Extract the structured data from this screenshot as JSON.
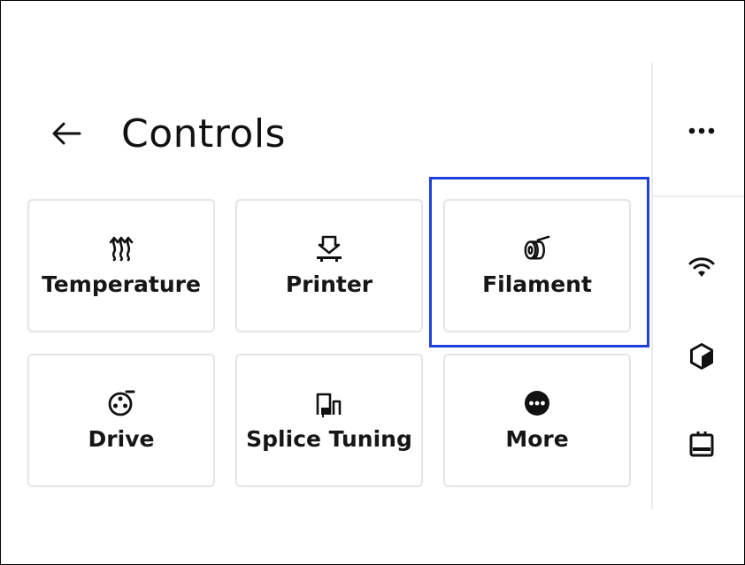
{
  "header": {
    "title": "Controls",
    "back_icon": "arrow-left-icon"
  },
  "tiles": [
    {
      "label": "Temperature",
      "icon": "heat-waves-icon"
    },
    {
      "label": "Printer",
      "icon": "print-head-icon"
    },
    {
      "label": "Filament",
      "icon": "filament-spool-icon",
      "highlighted": true
    },
    {
      "label": "Drive",
      "icon": "drive-gear-icon"
    },
    {
      "label": "Splice Tuning",
      "icon": "splice-tuning-icon"
    },
    {
      "label": "More",
      "icon": "more-circle-icon"
    }
  ],
  "sidebar": {
    "icons": [
      "more-dots-icon",
      "wifi-icon",
      "cube-icon",
      "printer-bed-icon"
    ]
  },
  "colors": {
    "highlight": "#1f3fdb",
    "tile_border": "#e4e4e4",
    "text": "#161616"
  }
}
